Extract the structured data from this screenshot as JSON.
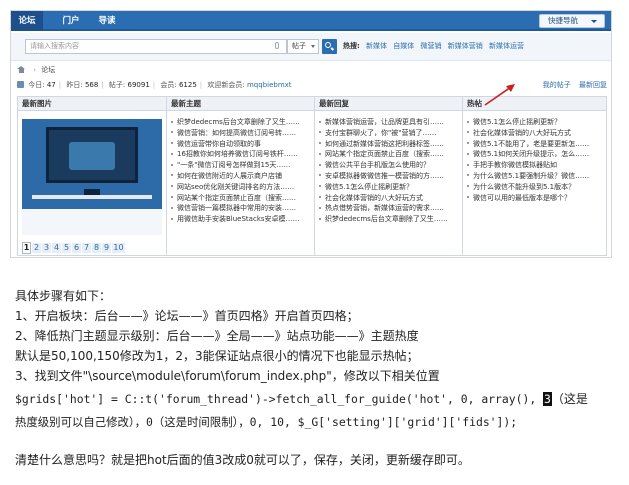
{
  "screenshot": {
    "nav": {
      "forum": "论坛",
      "portal": "门户",
      "guide": "导读",
      "quick_nav": "快捷导航"
    },
    "search": {
      "placeholder": "请输入搜索内容",
      "type_select": "帖子",
      "hot_label": "热搜:",
      "hot_keywords": [
        "新媒体",
        "自媒体",
        "微营销",
        "新媒体营销",
        "新媒体运营"
      ]
    },
    "breadcrumb": {
      "home_sep": "›",
      "current": "论坛"
    },
    "stats": {
      "today_label": "今日:",
      "today": "47",
      "yesterday_label": "昨日:",
      "yesterday": "568",
      "posts_label": "帖子:",
      "posts": "69091",
      "members_label": "会员:",
      "members": "6125",
      "newest_label": "欢迎新会员:",
      "newest": "mqqbiebmxt",
      "my_posts": "我的帖子",
      "latest_reply": "最新回复"
    },
    "columns": {
      "images": "最新图片",
      "new_topics": "最新主题",
      "new_replies": "最新回复",
      "hot_topics": "热帖"
    },
    "thumb_caption": "",
    "pager": [
      "1",
      "2",
      "3",
      "4",
      "5",
      "6",
      "7",
      "8",
      "9",
      "10"
    ],
    "pager_active": "1",
    "new_topics": [
      "织梦dedecms后台文章删除了又生……",
      "微信营销：如何提高微信订阅号转……",
      "微信运营带你自动领取的事",
      "16招教你如何培养微信订阅号铁杆……",
      "\"一条\"微信订阅号怎样做到15天……",
      "如何在微信附近的人展示商户店铺",
      "网站seo优化刚关键词排名的方法……",
      "网站某个指定页面禁止百度（搜索……",
      "微信营销一篇模拟器中常用的安装……",
      "用微信助手安装BlueStacks安卓模……"
    ],
    "new_replies": [
      "新媒体营销运营，让品牌更具有引……",
      "支付宝群聊火了，你\"被\"营销了……",
      "如何通过新媒体营销这把利器标签……",
      "网站某个指定页面禁止百度（搜索……",
      "微信公共平台手机版怎么使用的？",
      "安卓模拟器做微信推一模营销的方……",
      "微信5.1怎么停止摇刷更新？",
      "社会化媒体营销的八大好玩方式",
      "热点借势营销，新媒体运营的需求……",
      "织梦dedecms后台文章删除了又生……"
    ],
    "hot_topics": [
      "微信5.1怎么停止摇刷更新？",
      "社会化媒体营销的八大好玩方式",
      "微信5.1不能用了，老是要更新怎……",
      "微信5.1如何关闭升级提示，怎么……",
      "手把手教你微信模拟器贴如",
      "为什么微信5.1要强制升级？微信……",
      "为什么微信不能升级到5.1版本？",
      "微信可以用的最低版本是哪个？"
    ]
  },
  "article": {
    "intro": "具体步骤有如下：",
    "step1": "1、开启板块：后台——》论坛——》首页四格》开启首页四格；",
    "step2": "2、降低热门主题显示级别：后台——》全局——》站点功能——》主题热度",
    "note": "默认是50,100,150修改为1，2，3能保证站点很小的情况下也能显示热帖；",
    "step3": "3、找到文件\"\\source\\module\\forum\\forum_index.php\"，修改以下相关位置",
    "code_before": "$grids['hot'] = C::t('forum_thread')->fetch_all_for_guide('hot', 0, array(), ",
    "code_digit": "3",
    "code_after_cn": "（这是",
    "code_line2": "热度级别可以自己修改），0（这是时间限制），0, 10, $_G['setting']['grid']['fids']);",
    "conclusion": "清楚什么意思吗？就是把hot后面的值3改成0就可以了，保存，关闭，更新缓存即可。"
  }
}
